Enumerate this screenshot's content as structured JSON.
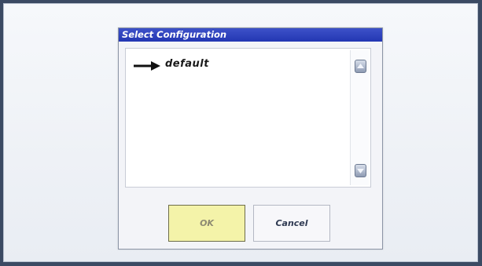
{
  "dialog": {
    "title": "Select Configuration",
    "list": {
      "items": [
        {
          "label": "default",
          "selected": true
        }
      ]
    },
    "buttons": {
      "ok_label": "OK",
      "cancel_label": "Cancel"
    }
  },
  "icons": {
    "selection_indicator": "right-arrow-icon",
    "scroll_up": "chevron-up-icon",
    "scroll_down": "chevron-down-icon"
  },
  "colors": {
    "title_bar": "#2337b3",
    "ok_button": "#f4f3a9",
    "background": "#eef1f6"
  }
}
